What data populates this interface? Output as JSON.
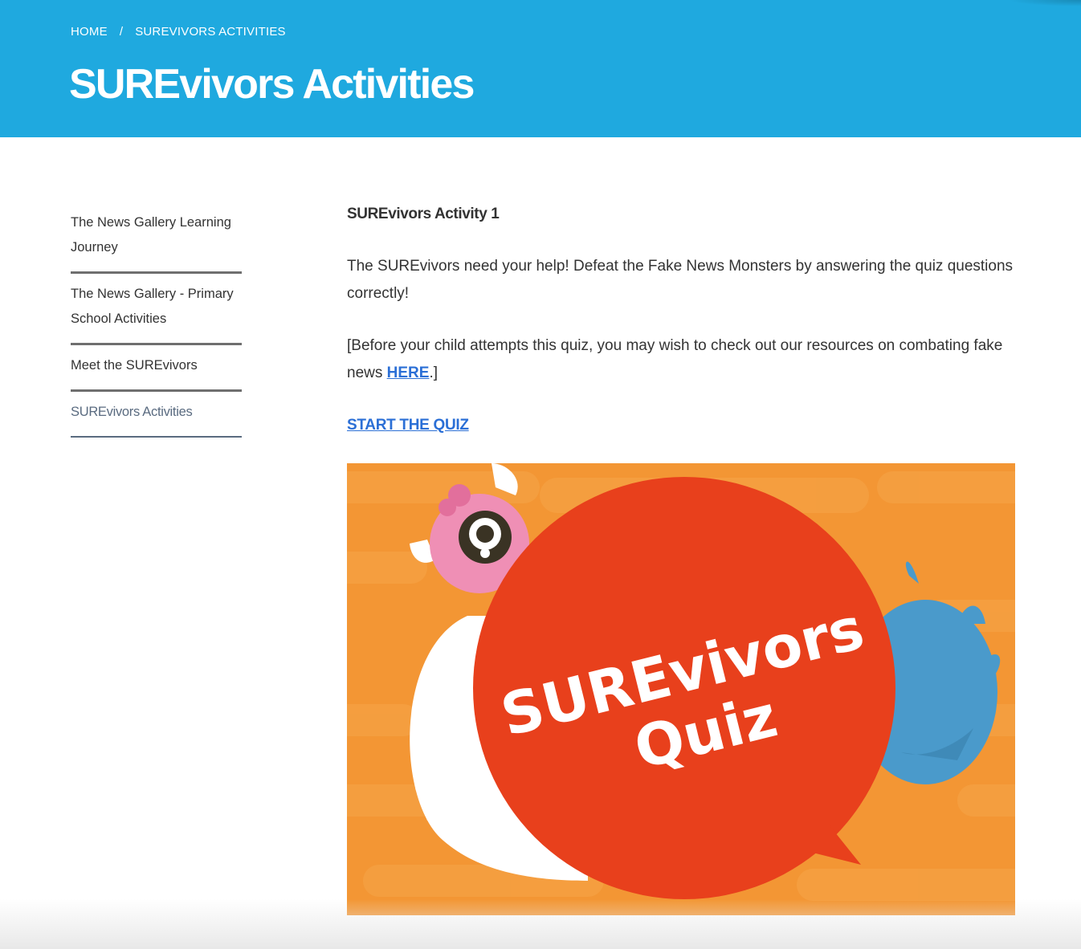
{
  "header": {
    "breadcrumb": {
      "home": "HOME",
      "separator": "/",
      "current": "SUREVIVORS ACTIVITIES"
    },
    "title": "SUREvivors Activities",
    "bg_color": "#1fa9df"
  },
  "sidebar": {
    "items": [
      {
        "label": "The News Gallery Learning Journey"
      },
      {
        "label": "The News Gallery - Primary School Activities"
      },
      {
        "label": "Meet the SUREvivors"
      },
      {
        "label": "SUREvivors Activities",
        "active": true
      }
    ]
  },
  "main": {
    "activity_title": "SUREvivors Activity 1",
    "intro": "The SUREvivors need your help! Defeat the Fake News Monsters by answering the quiz questions correctly!",
    "note_prefix": "[Before your child attempts this quiz, you may wish to check out our resources on combating fake news ",
    "note_link": "HERE",
    "note_suffix": ".]",
    "start_link": "START THE QUIZ",
    "link_color": "#2b6fd6",
    "image": {
      "line1": "SUREvivors",
      "line2": "Quiz",
      "background_color": "#f39634",
      "circle_color": "#e8401c"
    }
  }
}
